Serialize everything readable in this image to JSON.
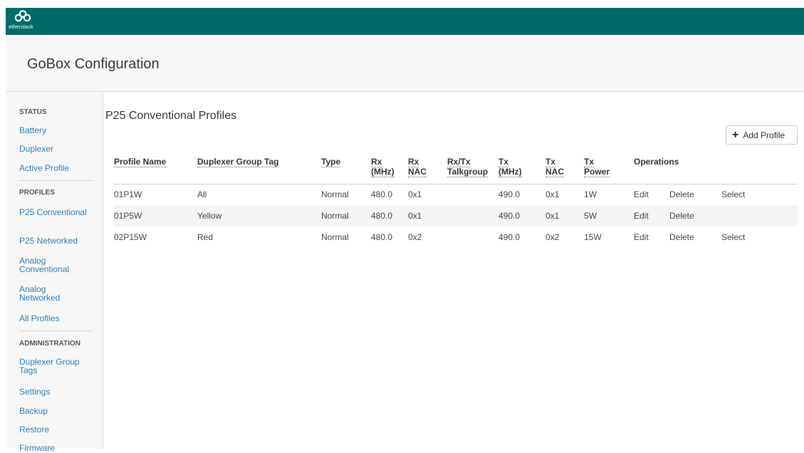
{
  "brand": {
    "logo_text": "etherstack"
  },
  "header": {
    "title": "GoBox Configuration"
  },
  "sidebar": {
    "sections": [
      {
        "heading": "STATUS",
        "items": [
          "Battery",
          "Duplexer",
          "Active Profile"
        ]
      },
      {
        "heading": "PROFILES",
        "items": [
          "P25 Conventional",
          "P25 Networked",
          "Analog Conventional",
          "Analog Networked",
          "All Profiles"
        ]
      },
      {
        "heading": "ADMINISTRATION",
        "items": [
          "Duplexer Group Tags",
          "Settings",
          "Backup",
          "Restore",
          "Firmware"
        ]
      }
    ]
  },
  "main": {
    "title": "P25 Conventional Profiles",
    "add_button_label": "Add Profile",
    "columns": [
      {
        "line1": "Profile Name",
        "line2": ""
      },
      {
        "line1": "Duplexer Group Tag",
        "line2": ""
      },
      {
        "line1": "Type",
        "line2": ""
      },
      {
        "line1": "Rx",
        "line2": "(MHz)"
      },
      {
        "line1": "Rx",
        "line2": "NAC"
      },
      {
        "line1": "Rx/Tx",
        "line2": "Talkgroup"
      },
      {
        "line1": "Tx",
        "line2": "(MHz)"
      },
      {
        "line1": "Tx",
        "line2": "NAC"
      },
      {
        "line1": "Tx",
        "line2": "Power"
      },
      {
        "line1": "Operations",
        "line2": ""
      }
    ],
    "rows": [
      {
        "name": "01P1W",
        "tag": "All",
        "type": "Normal",
        "rx_mhz": "480.0",
        "rx_nac": "0x1",
        "talkgroup": "",
        "tx_mhz": "490.0",
        "tx_nac": "0x1",
        "tx_power": "1W",
        "ops": [
          "Edit",
          "Delete",
          "Select"
        ]
      },
      {
        "name": "01P5W",
        "tag": "Yellow",
        "type": "Normal",
        "rx_mhz": "480.0",
        "rx_nac": "0x1",
        "talkgroup": "",
        "tx_mhz": "490.0",
        "tx_nac": "0x1",
        "tx_power": "5W",
        "ops": [
          "Edit",
          "Delete",
          ""
        ]
      },
      {
        "name": "02P15W",
        "tag": "Red",
        "type": "Normal",
        "rx_mhz": "480.0",
        "rx_nac": "0x2",
        "talkgroup": "",
        "tx_mhz": "490.0",
        "tx_nac": "0x2",
        "tx_power": "15W",
        "ops": [
          "Edit",
          "Delete",
          "Select"
        ]
      }
    ]
  },
  "colors": {
    "topbar": "#006b6a",
    "link": "#2d7fb8"
  }
}
